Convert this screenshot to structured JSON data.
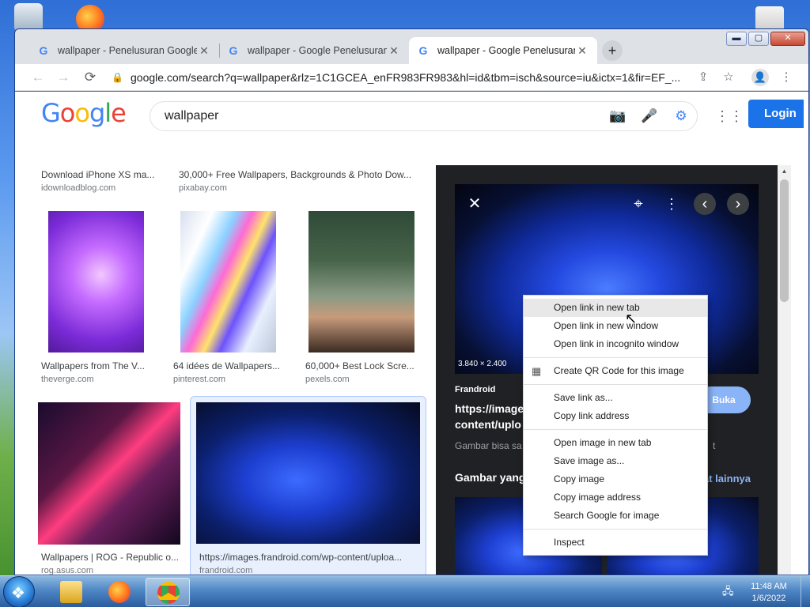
{
  "tabs": [
    {
      "title": "wallpaper - Penelusuran Google",
      "close": "✕"
    },
    {
      "title": "wallpaper - Google Penelusuran",
      "close": "✕"
    },
    {
      "title": "wallpaper - Google Penelusuran",
      "close": "✕"
    }
  ],
  "new_tab": "+",
  "window_controls": {
    "minimize": "▬",
    "maximize": "▢",
    "close": "✕"
  },
  "nav": {
    "back": "←",
    "forward": "→",
    "reload": "⟳"
  },
  "address": {
    "url": "google.com/search?q=wallpaper&rlz=1C1GCEA_enFR983FR983&hl=id&tbm=isch&source=iu&ictx=1&fir=EF_..."
  },
  "header": {
    "logo": {
      "g1": "G",
      "o1": "o",
      "o2": "o",
      "g2": "g",
      "l": "l",
      "e": "e"
    },
    "query": "wallpaper",
    "login": "Login"
  },
  "results_top": [
    {
      "title": "Download iPhone XS ma...",
      "source": "idownloadblog.com"
    },
    {
      "title": "30,000+ Free Wallpapers, Backgrounds & Photo Dow...",
      "source": "pixabay.com"
    }
  ],
  "results_row2": [
    {
      "title": "Wallpapers from The V...",
      "source": "theverge.com"
    },
    {
      "title": "64 idées de Wallpapers...",
      "source": "pinterest.com"
    },
    {
      "title": "60,000+ Best Lock Scre...",
      "source": "pexels.com"
    }
  ],
  "results_row3": [
    {
      "title": "Wallpapers | ROG - Republic o...",
      "source": "rog.asus.com"
    },
    {
      "title": "https://images.frandroid.com/wp-content/uploa...",
      "source": "frandroid.com"
    }
  ],
  "preview": {
    "close": "✕",
    "lens": "⌖",
    "more": "⋮",
    "prev": "‹",
    "next": "›",
    "dimensions": "3.840 × 2.400",
    "site": "Frandroid",
    "title_line1": "https://image",
    "title_line2": "content/uplo",
    "open_button": "Buka",
    "note": "Gambar bisa sa",
    "note_end": "t",
    "related": "Gambar yang",
    "see_more": "at lainnya"
  },
  "context_menu": {
    "group1": [
      "Open link in new tab",
      "Open link in new window",
      "Open link in incognito window"
    ],
    "qr": "Create QR Code for this image",
    "group2": [
      "Save link as...",
      "Copy link address"
    ],
    "group3": [
      "Open image in new tab",
      "Save image as...",
      "Copy image",
      "Copy image address",
      "Search Google for image"
    ],
    "inspect": "Inspect"
  },
  "taskbar": {
    "time": "11:48 AM",
    "date": "1/6/2022"
  }
}
